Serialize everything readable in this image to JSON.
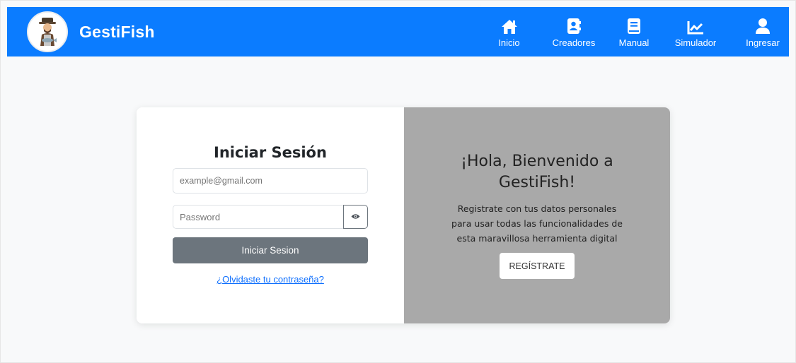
{
  "navbar": {
    "brand": "GestiFish",
    "background": "#0b7cff",
    "items": [
      {
        "label": "Inicio",
        "icon": "home-icon"
      },
      {
        "label": "Creadores",
        "icon": "address-book-icon"
      },
      {
        "label": "Manual",
        "icon": "book-icon"
      },
      {
        "label": "Simulador",
        "icon": "chart-line-icon"
      },
      {
        "label": "Ingresar",
        "icon": "user-icon"
      }
    ]
  },
  "login": {
    "title": "Iniciar Sesión",
    "email_placeholder": "example@gmail.com",
    "password_placeholder": "Password",
    "submit_label": "Iniciar Sesion",
    "forgot_label": "¿Olvidaste tu contraseña?"
  },
  "welcome": {
    "title_line1": "¡Hola, Bienvenido a",
    "title_line2": "GestiFish!",
    "text_line1": "Registrate con tus datos personales",
    "text_line2": "para usar todas las funcionalidades de",
    "text_line3": "esta maravillosa herramienta digital",
    "register_label": "REGÍSTRATE",
    "panel_color": "#a9a9a9"
  }
}
